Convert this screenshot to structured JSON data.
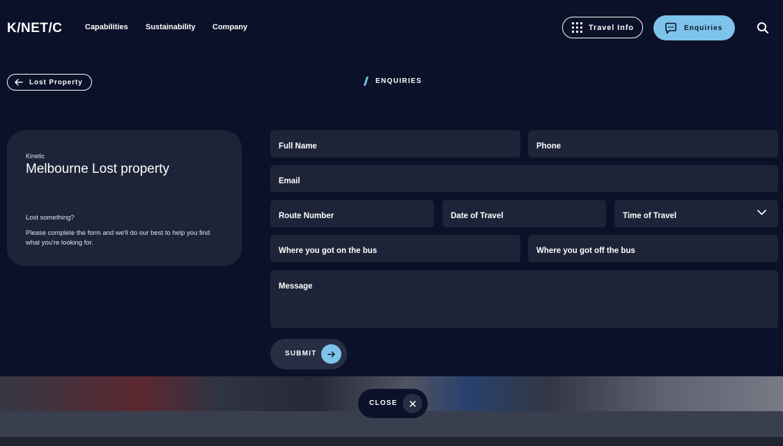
{
  "brand": {
    "logo": "K/NET/C"
  },
  "nav": {
    "links": [
      "Capabilities",
      "Sustainability",
      "Company"
    ],
    "travel_info_label": "Travel Info",
    "enquiries_label": "Enquiries",
    "search_icon": "search-icon"
  },
  "breadcrumb": {
    "back_label": "Lost Property",
    "current": "ENQUIRIES"
  },
  "info_card": {
    "eyebrow": "Kinetic",
    "title": "Melbourne Lost property",
    "subtitle": "Lost something?",
    "description": "Please complete the form and we'll do our best to help you find what you're looking for."
  },
  "form": {
    "full_name": "Full Name",
    "phone": "Phone",
    "email": "Email",
    "route_number": "Route Number",
    "date_of_travel": "Date of Travel",
    "time_of_travel": "Time of Travel",
    "got_on": "Where you got on the bus",
    "got_off": "Where you got off the bus",
    "message": "Message",
    "submit_label": "SUBMIT"
  },
  "footer": {
    "close_label": "CLOSE"
  },
  "colors": {
    "background": "#0b1128",
    "panel": "#1e2438",
    "accent": "#7ec3ea"
  }
}
